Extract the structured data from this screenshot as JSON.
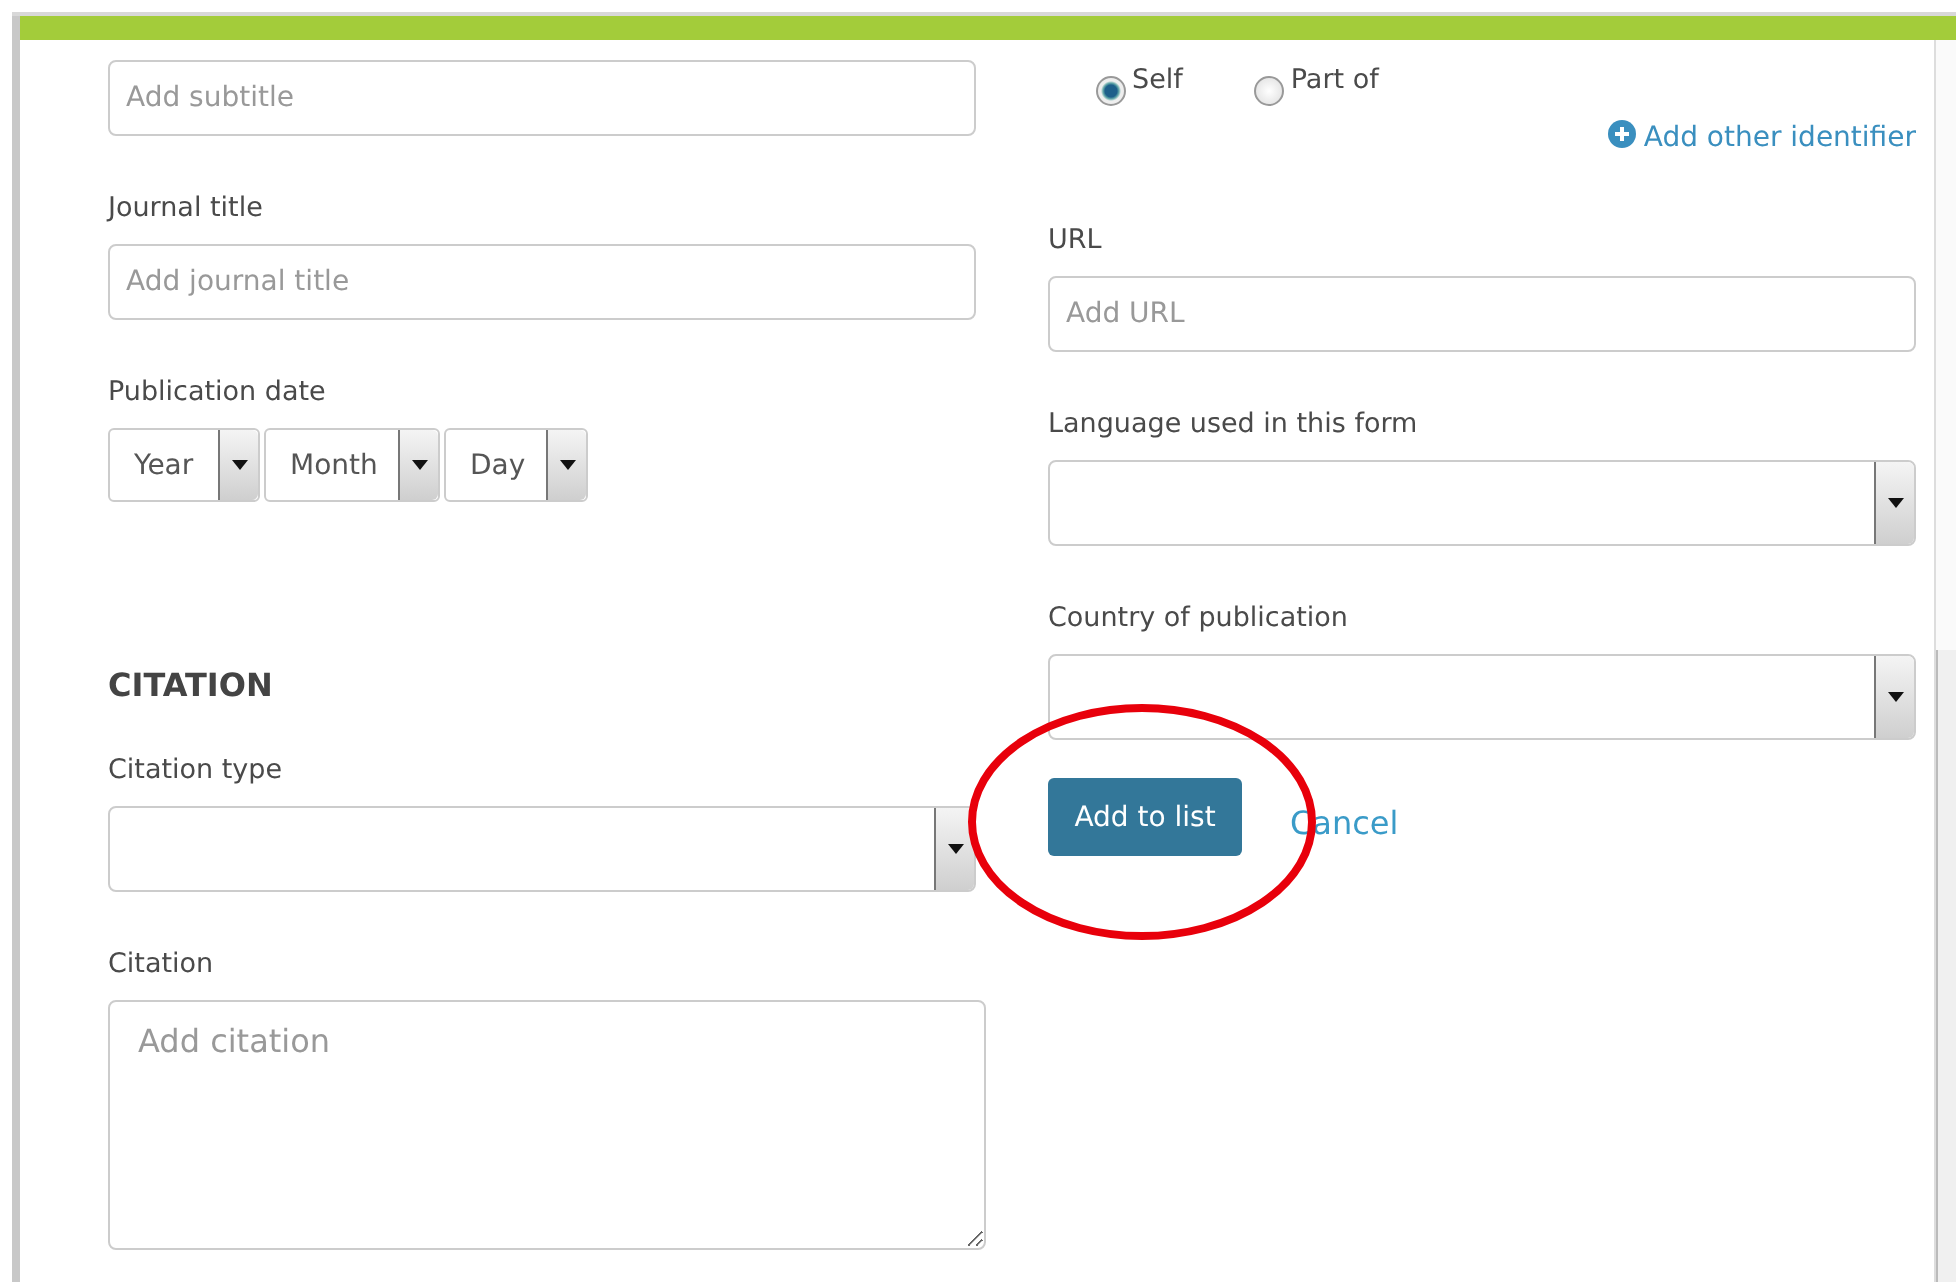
{
  "left_column": [
    {
      "kind": "input",
      "placeholder": "Add subtitle"
    },
    {
      "kind": "input",
      "label": "Journal title",
      "placeholder": "Add journal title"
    },
    {
      "kind": "date",
      "label": "Publication date",
      "parts": [
        "Year",
        "Month",
        "Day"
      ]
    },
    {
      "kind": "heading",
      "text": "CITATION"
    },
    {
      "kind": "select",
      "label": "Citation type"
    },
    {
      "kind": "textarea",
      "label": "Citation",
      "placeholder": "Add citation"
    }
  ],
  "right_column": [
    {
      "kind": "radios",
      "options": [
        {
          "label": "Self",
          "selected": true
        },
        {
          "label": "Part of",
          "selected": false
        }
      ]
    },
    {
      "kind": "link",
      "text": "Add other identifier"
    },
    {
      "kind": "input",
      "label": "URL",
      "placeholder": "Add URL"
    },
    {
      "kind": "select",
      "label": "Language used in this form"
    },
    {
      "kind": "select",
      "label": "Country of publication"
    },
    {
      "kind": "actions",
      "primary": "Add to list",
      "secondary": "Cancel"
    }
  ]
}
